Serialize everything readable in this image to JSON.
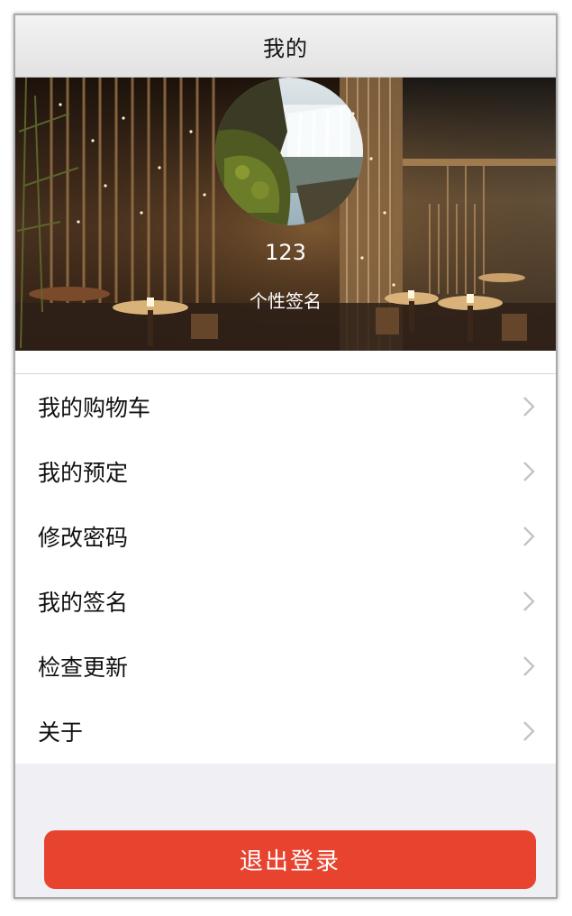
{
  "navbar": {
    "title": "我的"
  },
  "profile": {
    "username": "123",
    "signature": "个性签名",
    "avatar_icon": "avatar-waterfall-image",
    "banner_image": "restaurant-interior-background"
  },
  "menu": {
    "items": [
      {
        "label": "我的购物车",
        "icon": "chevron-right-icon"
      },
      {
        "label": "我的预定",
        "icon": "chevron-right-icon"
      },
      {
        "label": "修改密码",
        "icon": "chevron-right-icon"
      },
      {
        "label": "我的签名",
        "icon": "chevron-right-icon"
      },
      {
        "label": "检查更新",
        "icon": "chevron-right-icon"
      },
      {
        "label": "关于",
        "icon": "chevron-right-icon"
      }
    ]
  },
  "logout": {
    "label": "退出登录"
  },
  "colors": {
    "accent": "#e8432f",
    "background": "#efeff4",
    "navbar": "#e8e8e8"
  }
}
